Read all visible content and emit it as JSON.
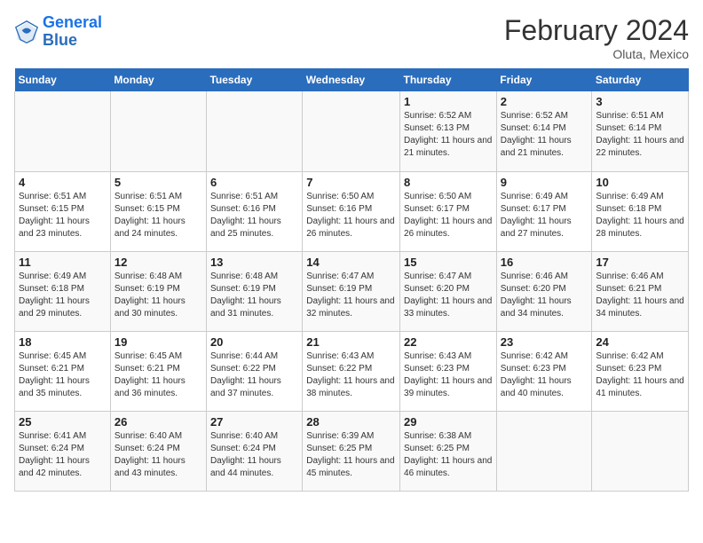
{
  "header": {
    "logo_line1": "General",
    "logo_line2": "Blue",
    "month_title": "February 2024",
    "location": "Oluta, Mexico"
  },
  "days_of_week": [
    "Sunday",
    "Monday",
    "Tuesday",
    "Wednesday",
    "Thursday",
    "Friday",
    "Saturday"
  ],
  "weeks": [
    [
      {
        "day": "",
        "info": ""
      },
      {
        "day": "",
        "info": ""
      },
      {
        "day": "",
        "info": ""
      },
      {
        "day": "",
        "info": ""
      },
      {
        "day": "1",
        "info": "Sunrise: 6:52 AM\nSunset: 6:13 PM\nDaylight: 11 hours and 21 minutes."
      },
      {
        "day": "2",
        "info": "Sunrise: 6:52 AM\nSunset: 6:14 PM\nDaylight: 11 hours and 21 minutes."
      },
      {
        "day": "3",
        "info": "Sunrise: 6:51 AM\nSunset: 6:14 PM\nDaylight: 11 hours and 22 minutes."
      }
    ],
    [
      {
        "day": "4",
        "info": "Sunrise: 6:51 AM\nSunset: 6:15 PM\nDaylight: 11 hours and 23 minutes."
      },
      {
        "day": "5",
        "info": "Sunrise: 6:51 AM\nSunset: 6:15 PM\nDaylight: 11 hours and 24 minutes."
      },
      {
        "day": "6",
        "info": "Sunrise: 6:51 AM\nSunset: 6:16 PM\nDaylight: 11 hours and 25 minutes."
      },
      {
        "day": "7",
        "info": "Sunrise: 6:50 AM\nSunset: 6:16 PM\nDaylight: 11 hours and 26 minutes."
      },
      {
        "day": "8",
        "info": "Sunrise: 6:50 AM\nSunset: 6:17 PM\nDaylight: 11 hours and 26 minutes."
      },
      {
        "day": "9",
        "info": "Sunrise: 6:49 AM\nSunset: 6:17 PM\nDaylight: 11 hours and 27 minutes."
      },
      {
        "day": "10",
        "info": "Sunrise: 6:49 AM\nSunset: 6:18 PM\nDaylight: 11 hours and 28 minutes."
      }
    ],
    [
      {
        "day": "11",
        "info": "Sunrise: 6:49 AM\nSunset: 6:18 PM\nDaylight: 11 hours and 29 minutes."
      },
      {
        "day": "12",
        "info": "Sunrise: 6:48 AM\nSunset: 6:19 PM\nDaylight: 11 hours and 30 minutes."
      },
      {
        "day": "13",
        "info": "Sunrise: 6:48 AM\nSunset: 6:19 PM\nDaylight: 11 hours and 31 minutes."
      },
      {
        "day": "14",
        "info": "Sunrise: 6:47 AM\nSunset: 6:19 PM\nDaylight: 11 hours and 32 minutes."
      },
      {
        "day": "15",
        "info": "Sunrise: 6:47 AM\nSunset: 6:20 PM\nDaylight: 11 hours and 33 minutes."
      },
      {
        "day": "16",
        "info": "Sunrise: 6:46 AM\nSunset: 6:20 PM\nDaylight: 11 hours and 34 minutes."
      },
      {
        "day": "17",
        "info": "Sunrise: 6:46 AM\nSunset: 6:21 PM\nDaylight: 11 hours and 34 minutes."
      }
    ],
    [
      {
        "day": "18",
        "info": "Sunrise: 6:45 AM\nSunset: 6:21 PM\nDaylight: 11 hours and 35 minutes."
      },
      {
        "day": "19",
        "info": "Sunrise: 6:45 AM\nSunset: 6:21 PM\nDaylight: 11 hours and 36 minutes."
      },
      {
        "day": "20",
        "info": "Sunrise: 6:44 AM\nSunset: 6:22 PM\nDaylight: 11 hours and 37 minutes."
      },
      {
        "day": "21",
        "info": "Sunrise: 6:43 AM\nSunset: 6:22 PM\nDaylight: 11 hours and 38 minutes."
      },
      {
        "day": "22",
        "info": "Sunrise: 6:43 AM\nSunset: 6:23 PM\nDaylight: 11 hours and 39 minutes."
      },
      {
        "day": "23",
        "info": "Sunrise: 6:42 AM\nSunset: 6:23 PM\nDaylight: 11 hours and 40 minutes."
      },
      {
        "day": "24",
        "info": "Sunrise: 6:42 AM\nSunset: 6:23 PM\nDaylight: 11 hours and 41 minutes."
      }
    ],
    [
      {
        "day": "25",
        "info": "Sunrise: 6:41 AM\nSunset: 6:24 PM\nDaylight: 11 hours and 42 minutes."
      },
      {
        "day": "26",
        "info": "Sunrise: 6:40 AM\nSunset: 6:24 PM\nDaylight: 11 hours and 43 minutes."
      },
      {
        "day": "27",
        "info": "Sunrise: 6:40 AM\nSunset: 6:24 PM\nDaylight: 11 hours and 44 minutes."
      },
      {
        "day": "28",
        "info": "Sunrise: 6:39 AM\nSunset: 6:25 PM\nDaylight: 11 hours and 45 minutes."
      },
      {
        "day": "29",
        "info": "Sunrise: 6:38 AM\nSunset: 6:25 PM\nDaylight: 11 hours and 46 minutes."
      },
      {
        "day": "",
        "info": ""
      },
      {
        "day": "",
        "info": ""
      }
    ]
  ]
}
